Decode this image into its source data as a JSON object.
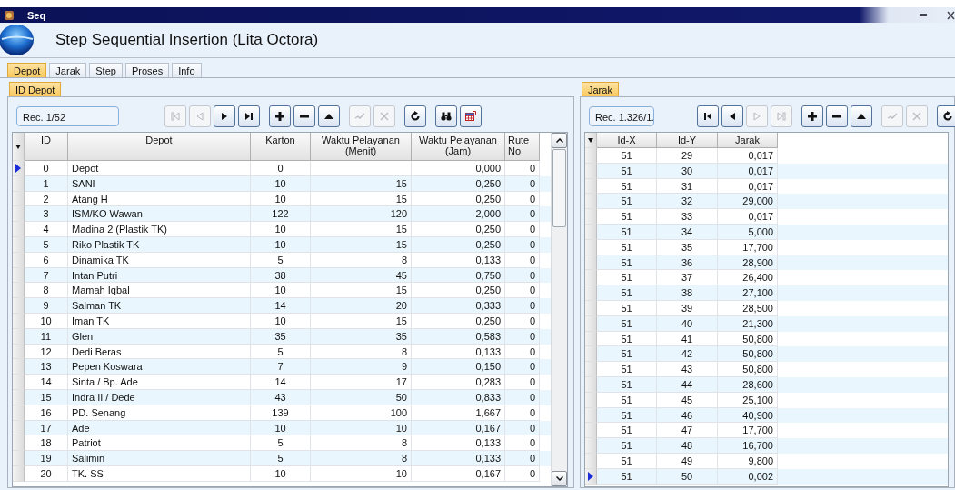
{
  "window": {
    "title": "Seq"
  },
  "header": {
    "title": "Step Sequential Insertion (Lita Octora)"
  },
  "tabs": [
    {
      "label": "Depot",
      "selected": true
    },
    {
      "label": "Jarak",
      "selected": false
    },
    {
      "label": "Step",
      "selected": false
    },
    {
      "label": "Proses",
      "selected": false
    },
    {
      "label": "Info",
      "selected": false
    }
  ],
  "panels": [
    {
      "tab": {
        "label": "ID Depot",
        "selected": true
      },
      "record": "Rec. 1/52",
      "navigator": [
        {
          "kind": "first",
          "disabled": true
        },
        {
          "kind": "prior",
          "disabled": true
        },
        {
          "kind": "next",
          "disabled": false
        },
        {
          "kind": "last",
          "disabled": false
        },
        {
          "kind": "insert",
          "disabled": false
        },
        {
          "kind": "delete",
          "disabled": false
        },
        {
          "kind": "edit",
          "disabled": false
        },
        {
          "kind": "post",
          "disabled": true
        },
        {
          "kind": "cancel",
          "disabled": true
        },
        {
          "kind": "refresh",
          "disabled": false
        },
        {
          "kind": "search",
          "disabled": false
        },
        {
          "kind": "export",
          "disabled": false
        }
      ],
      "table": {
        "columns": [
          "ID",
          "Depot",
          "Karton",
          "Waktu Pelayanan (Menit)",
          "Waktu Pelayanan (Jam)",
          "Rute No"
        ],
        "rows": [
          {
            "cells": [
              "0",
              "Depot",
              "0",
              null,
              "0,000",
              "0"
            ],
            "selected": true
          },
          {
            "cells": [
              "1",
              "SANI",
              "10",
              "15",
              "0,250",
              "0"
            ],
            "selected": false
          },
          {
            "cells": [
              "2",
              "Atang H",
              "10",
              "15",
              "0,250",
              "0"
            ],
            "selected": false
          },
          {
            "cells": [
              "3",
              "ISM/KO Wawan",
              "122",
              "120",
              "2,000",
              "0"
            ],
            "selected": false
          },
          {
            "cells": [
              "4",
              "Madina 2 (Plastik TK)",
              "10",
              "15",
              "0,250",
              "0"
            ],
            "selected": false
          },
          {
            "cells": [
              "5",
              "Riko Plastik TK",
              "10",
              "15",
              "0,250",
              "0"
            ],
            "selected": false
          },
          {
            "cells": [
              "6",
              "Dinamika TK",
              "5",
              "8",
              "0,133",
              "0"
            ],
            "selected": false
          },
          {
            "cells": [
              "7",
              "Intan Putri",
              "38",
              "45",
              "0,750",
              "0"
            ],
            "selected": false
          },
          {
            "cells": [
              "8",
              "Mamah Iqbal",
              "10",
              "15",
              "0,250",
              "0"
            ],
            "selected": false
          },
          {
            "cells": [
              "9",
              "Salman TK",
              "14",
              "20",
              "0,333",
              "0"
            ],
            "selected": false
          },
          {
            "cells": [
              "10",
              "Iman TK",
              "10",
              "15",
              "0,250",
              "0"
            ],
            "selected": false
          },
          {
            "cells": [
              "11",
              "Glen",
              "35",
              "35",
              "0,583",
              "0"
            ],
            "selected": false
          },
          {
            "cells": [
              "12",
              "Dedi Beras",
              "5",
              "8",
              "0,133",
              "0"
            ],
            "selected": false
          },
          {
            "cells": [
              "13",
              "Pepen Koswara",
              "7",
              "9",
              "0,150",
              "0"
            ],
            "selected": false
          },
          {
            "cells": [
              "14",
              "Sinta / Bp. Ade",
              "14",
              "17",
              "0,283",
              "0"
            ],
            "selected": false
          },
          {
            "cells": [
              "15",
              "Indra II / Dede",
              "43",
              "50",
              "0,833",
              "0"
            ],
            "selected": false
          },
          {
            "cells": [
              "16",
              "PD. Senang",
              "139",
              "100",
              "1,667",
              "0"
            ],
            "selected": false
          },
          {
            "cells": [
              "17",
              "Ade",
              "10",
              "10",
              "0,167",
              "0"
            ],
            "selected": false
          },
          {
            "cells": [
              "18",
              "Patriot",
              "5",
              "8",
              "0,133",
              "0"
            ],
            "selected": false
          },
          {
            "cells": [
              "19",
              "Salimin",
              "5",
              "8",
              "0,133",
              "0"
            ],
            "selected": false
          },
          {
            "cells": [
              "20",
              "TK. SS",
              "10",
              "10",
              "0,167",
              "0"
            ],
            "selected": false
          }
        ]
      }
    },
    {
      "tab": {
        "label": "Jarak",
        "selected": true
      },
      "record": "Rec. 1.326/1.",
      "navigator": [
        {
          "kind": "first",
          "disabled": false
        },
        {
          "kind": "prior",
          "disabled": false
        },
        {
          "kind": "next",
          "disabled": true
        },
        {
          "kind": "last",
          "disabled": true
        },
        {
          "kind": "insert",
          "disabled": false
        },
        {
          "kind": "delete",
          "disabled": false
        },
        {
          "kind": "edit",
          "disabled": false
        },
        {
          "kind": "post",
          "disabled": true
        },
        {
          "kind": "cancel",
          "disabled": true
        },
        {
          "kind": "refresh",
          "disabled": false
        }
      ],
      "table": {
        "columns": [
          "Id-X",
          "Id-Y",
          "Jarak"
        ],
        "rows": [
          {
            "cells": [
              "51",
              "29",
              "0,017"
            ],
            "selected": false
          },
          {
            "cells": [
              "51",
              "30",
              "0,017"
            ],
            "selected": false
          },
          {
            "cells": [
              "51",
              "31",
              "0,017"
            ],
            "selected": false
          },
          {
            "cells": [
              "51",
              "32",
              "29,000"
            ],
            "selected": false
          },
          {
            "cells": [
              "51",
              "33",
              "0,017"
            ],
            "selected": false
          },
          {
            "cells": [
              "51",
              "34",
              "5,000"
            ],
            "selected": false
          },
          {
            "cells": [
              "51",
              "35",
              "17,700"
            ],
            "selected": false
          },
          {
            "cells": [
              "51",
              "36",
              "28,900"
            ],
            "selected": false
          },
          {
            "cells": [
              "51",
              "37",
              "26,400"
            ],
            "selected": false
          },
          {
            "cells": [
              "51",
              "38",
              "27,100"
            ],
            "selected": false
          },
          {
            "cells": [
              "51",
              "39",
              "28,500"
            ],
            "selected": false
          },
          {
            "cells": [
              "51",
              "40",
              "21,300"
            ],
            "selected": false
          },
          {
            "cells": [
              "51",
              "41",
              "50,800"
            ],
            "selected": false
          },
          {
            "cells": [
              "51",
              "42",
              "50,800"
            ],
            "selected": false
          },
          {
            "cells": [
              "51",
              "43",
              "50,800"
            ],
            "selected": false
          },
          {
            "cells": [
              "51",
              "44",
              "28,600"
            ],
            "selected": false
          },
          {
            "cells": [
              "51",
              "45",
              "25,100"
            ],
            "selected": false
          },
          {
            "cells": [
              "51",
              "46",
              "40,900"
            ],
            "selected": false
          },
          {
            "cells": [
              "51",
              "47",
              "17,700"
            ],
            "selected": false
          },
          {
            "cells": [
              "51",
              "48",
              "16,700"
            ],
            "selected": false
          },
          {
            "cells": [
              "51",
              "49",
              "9,800"
            ],
            "selected": false
          },
          {
            "cells": [
              "51",
              "50",
              "0,002"
            ],
            "selected": true
          }
        ]
      }
    }
  ]
}
